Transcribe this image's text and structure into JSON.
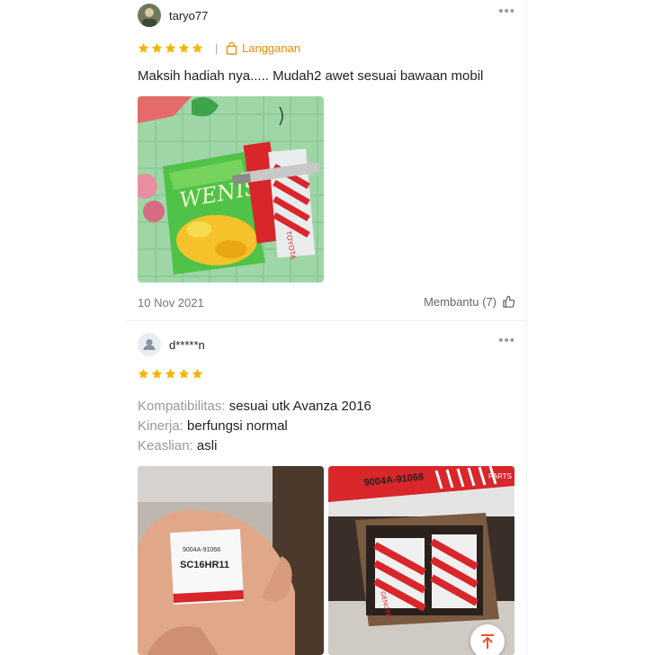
{
  "reviews": [
    {
      "username": "taryo77",
      "rating": 5,
      "separator": "|",
      "variant_label": "Langganan",
      "text": "Maksih hadiah nya..... Mudah2 awet sesuai bawaan mobil",
      "date": "10 Nov 2021",
      "helpful_label": "Membantu (7)",
      "more": "•••",
      "photo": {
        "bag_brand": "WENIS",
        "box_text": "TOYOTA"
      }
    },
    {
      "username": "d*****n",
      "rating": 5,
      "more": "•••",
      "attributes": [
        {
          "key": "Kompatibilitas:",
          "value": "sesuai utk Avanza 2016"
        },
        {
          "key": "Kinerja:",
          "value": "berfungsi normal"
        },
        {
          "key": "Keaslian:",
          "value": "asli"
        }
      ],
      "photos": [
        {
          "part_no": "9004A-91068",
          "model": "SC16HR11"
        },
        {
          "part_no": "9004A-91068",
          "side_text": "GENUINE",
          "corner_text": "PARTS"
        }
      ]
    }
  ],
  "colors": {
    "star": "#f6b400",
    "variant": "#ee8a00"
  },
  "icons": [
    "more-icon",
    "bag-icon",
    "thumbs-up-icon",
    "star-icon",
    "scroll-top-icon",
    "avatar-default-icon"
  ]
}
